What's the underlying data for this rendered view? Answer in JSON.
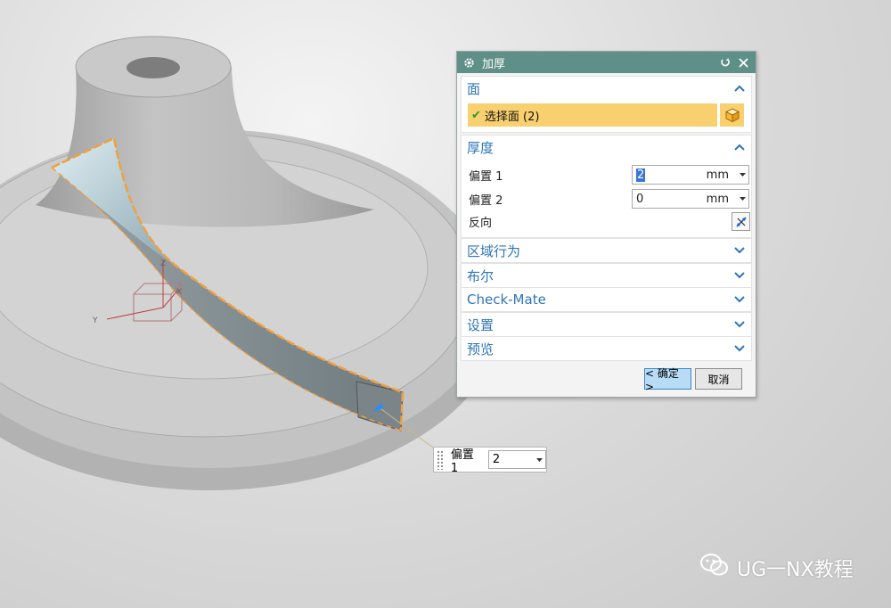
{
  "viewport": {
    "axes": {
      "x": "X",
      "y": "Y",
      "z": "Z"
    }
  },
  "dialog": {
    "title": "加厚",
    "sections": {
      "face": {
        "title": "面",
        "select_label": "选择面 (2)"
      },
      "thickness": {
        "title": "厚度",
        "offset1_label": "偏置 1",
        "offset1_value": "2",
        "offset1_unit": "mm",
        "offset2_label": "偏置 2",
        "offset2_value": "0",
        "offset2_unit": "mm",
        "reverse_label": "反向"
      },
      "region": {
        "title": "区域行为"
      },
      "boolean": {
        "title": "布尔"
      },
      "checkmate": {
        "title": "Check-Mate"
      },
      "settings": {
        "title": "设置"
      },
      "preview": {
        "title": "预览"
      }
    },
    "ok_label": "< 确定 >",
    "cancel_label": "取消"
  },
  "floating_input": {
    "label": "偏置 1",
    "value": "2"
  },
  "watermark": "UG一NX教程",
  "colors": {
    "titlebar": "#5e8f88",
    "accent": "#2e75b6",
    "selection": "#f9d06f",
    "highlight": "#f0a040"
  }
}
